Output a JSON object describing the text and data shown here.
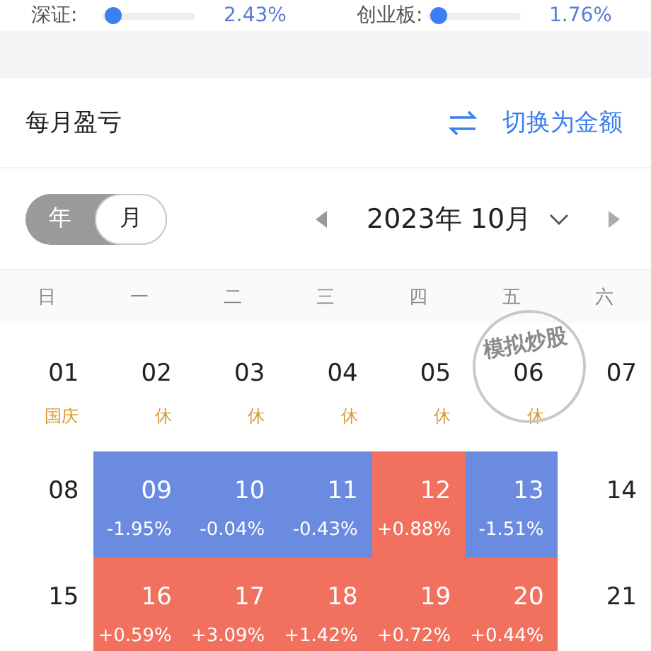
{
  "market": [
    {
      "label": "深证:",
      "level": 0.04,
      "value": "2.43%"
    },
    {
      "label": "创业板:",
      "level": 0.04,
      "value": "1.76%"
    }
  ],
  "section": {
    "title": "每月盈亏",
    "action": "切换为金额"
  },
  "period_toggle": [
    {
      "label": "年",
      "selected": false
    },
    {
      "label": "月",
      "selected": true
    }
  ],
  "month_nav": {
    "title": "2023年 10月"
  },
  "weekdays": [
    "日",
    "一",
    "二",
    "三",
    "四",
    "五",
    "六"
  ],
  "stamp": "模拟炒股",
  "weeks": [
    [
      {
        "day": "01",
        "note": "国庆"
      },
      {
        "day": "02",
        "note": "休"
      },
      {
        "day": "03",
        "note": "休"
      },
      {
        "day": "04",
        "note": "休"
      },
      {
        "day": "05",
        "note": "休"
      },
      {
        "day": "06",
        "note": "休"
      },
      {
        "day": "07"
      }
    ],
    [
      {
        "day": "08"
      },
      {
        "day": "09",
        "change": "-1.95%",
        "color": "#6a8be0"
      },
      {
        "day": "10",
        "change": "-0.04%",
        "color": "#6a8be0"
      },
      {
        "day": "11",
        "change": "-0.43%",
        "color": "#6a8be0"
      },
      {
        "day": "12",
        "change": "+0.88%",
        "color": "#f1705e"
      },
      {
        "day": "13",
        "change": "-1.51%",
        "color": "#6a8be0"
      },
      {
        "day": "14"
      }
    ],
    [
      {
        "day": "15"
      },
      {
        "day": "16",
        "change": "+0.59%",
        "color": "#f1705e"
      },
      {
        "day": "17",
        "change": "+3.09%",
        "color": "#f1705e"
      },
      {
        "day": "18",
        "change": "+1.42%",
        "color": "#f1705e"
      },
      {
        "day": "19",
        "change": "+0.72%",
        "color": "#f1705e"
      },
      {
        "day": "20",
        "change": "+0.44%",
        "color": "#f1705e"
      },
      {
        "day": "21"
      }
    ]
  ]
}
